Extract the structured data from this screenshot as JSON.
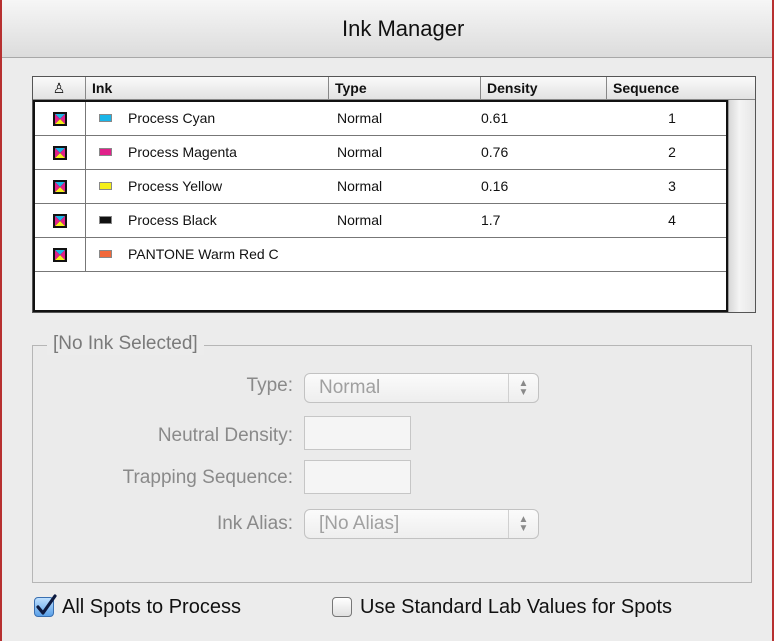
{
  "window": {
    "title": "Ink Manager"
  },
  "table": {
    "columns": {
      "icon": "♙",
      "ink": "Ink",
      "type": "Type",
      "density": "Density",
      "sequence": "Sequence"
    },
    "rows": [
      {
        "name": "Process Cyan",
        "type": "Normal",
        "density": "0.61",
        "sequence": "1",
        "swatch": "#1ab5e8"
      },
      {
        "name": "Process Magenta",
        "type": "Normal",
        "density": "0.76",
        "sequence": "2",
        "swatch": "#e0208a"
      },
      {
        "name": "Process Yellow",
        "type": "Normal",
        "density": "0.16",
        "sequence": "3",
        "swatch": "#f5ef1a"
      },
      {
        "name": "Process Black",
        "type": "Normal",
        "density": "1.7",
        "sequence": "4",
        "swatch": "#111111"
      },
      {
        "name": "PANTONE Warm Red C",
        "type": "",
        "density": "",
        "sequence": "",
        "swatch": "#f2683a"
      }
    ]
  },
  "details": {
    "group_title": "[No Ink Selected]",
    "type_label": "Type:",
    "type_value": "Normal",
    "neutral_density_label": "Neutral Density:",
    "trapping_sequence_label": "Trapping Sequence:",
    "ink_alias_label": "Ink Alias:",
    "ink_alias_value": "[No Alias]"
  },
  "options": {
    "all_spots_to_process": {
      "label": "All Spots to Process",
      "checked": true
    },
    "standard_lab_values": {
      "label": "Use Standard Lab Values for Spots",
      "checked": false
    }
  },
  "colors": {
    "frame_accent": "#b73030",
    "check_blue": "#3a6fb0"
  }
}
